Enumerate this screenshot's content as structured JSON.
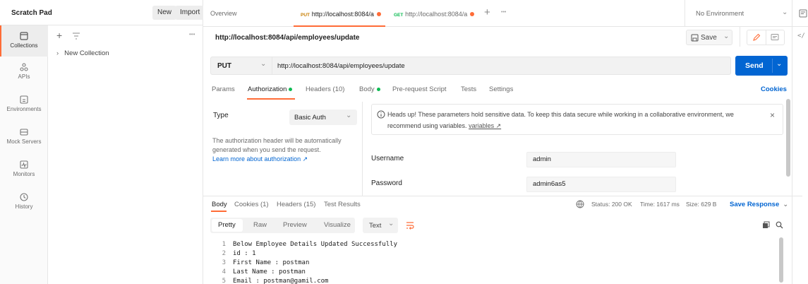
{
  "sidebar": {
    "title": "Scratch Pad",
    "new_label": "New",
    "import_label": "Import",
    "items": [
      {
        "label": "Collections",
        "icon": "collections-icon"
      },
      {
        "label": "APIs",
        "icon": "apis-icon"
      },
      {
        "label": "Environments",
        "icon": "environments-icon"
      },
      {
        "label": "Mock Servers",
        "icon": "mock-servers-icon"
      },
      {
        "label": "Monitors",
        "icon": "monitors-icon"
      },
      {
        "label": "History",
        "icon": "history-icon"
      }
    ],
    "more": "•••",
    "collection_label": "New Collection"
  },
  "tabs": {
    "overview": "Overview",
    "tab1_method": "PUT",
    "tab1_label": "http://localhost:8084/a",
    "tab2_method": "GET",
    "tab2_label": "http://localhost:8084/a",
    "add": "+",
    "more": "•••",
    "environment": "No Environment"
  },
  "request": {
    "title": "http://localhost:8084/api/employees/update",
    "save_label": "Save",
    "method": "PUT",
    "url": "http://localhost:8084/api/employees/update",
    "send_label": "Send",
    "tabs": [
      "Params",
      "Authorization",
      "Headers (10)",
      "Body",
      "Pre-request Script",
      "Tests",
      "Settings"
    ],
    "cookies_label": "Cookies"
  },
  "auth": {
    "type_label": "Type",
    "type_value": "Basic Auth",
    "description": "The authorization header will be automatically generated when you send the request.",
    "learn_more": "Learn more about authorization ↗",
    "warning_text": "Heads up! These parameters hold sensitive data. To keep this data secure while working in a collaborative environment, we",
    "warning_text2": "recommend using variables.",
    "warning_link": "variables ↗",
    "username_label": "Username",
    "username_value": "admin",
    "password_label": "Password",
    "password_value": "admin6as5"
  },
  "response": {
    "tabs": [
      "Body",
      "Cookies (1)",
      "Headers (15)",
      "Test Results"
    ],
    "status": "Status: 200 OK",
    "time": "Time: 1617 ms",
    "size": "Size: 629 B",
    "save_response": "Save Response",
    "views": [
      "Pretty",
      "Raw",
      "Preview",
      "Visualize"
    ],
    "format": "Text",
    "lines": [
      {
        "n": "1",
        "text": "Below Employee Details Updated Successfully"
      },
      {
        "n": "2",
        "text": "id : 1"
      },
      {
        "n": "3",
        "text": "First Name : postman"
      },
      {
        "n": "4",
        "text": "Last Name : postman"
      },
      {
        "n": "5",
        "text": "Email : postman@gamil.com"
      }
    ]
  },
  "colors": {
    "accent": "#ff6c37",
    "send_blue": "#0265d2",
    "link_blue": "#0265d2",
    "status_green": "#0cbb52"
  }
}
